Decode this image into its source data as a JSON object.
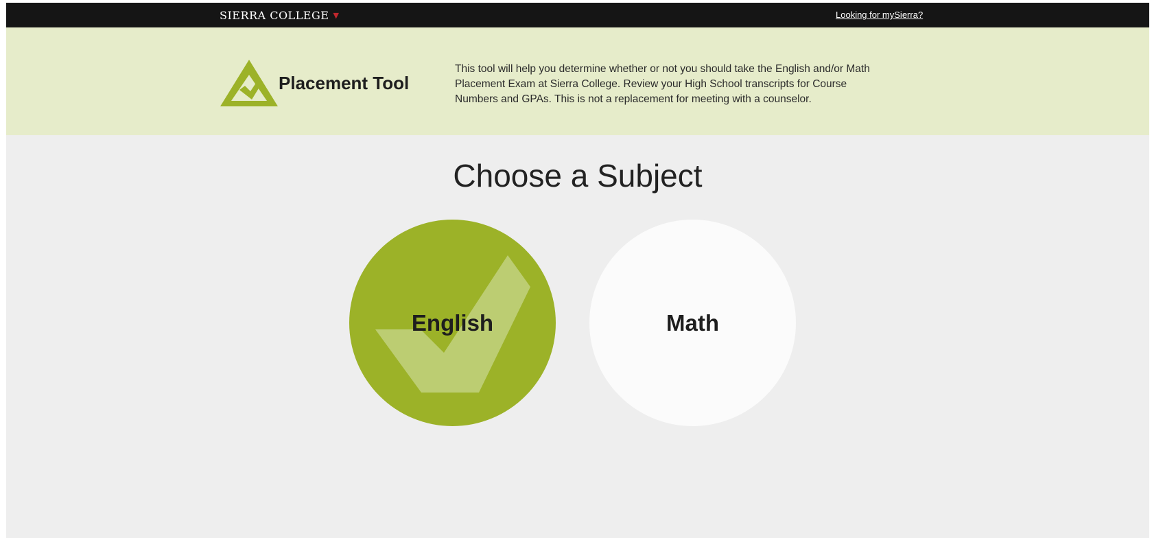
{
  "topbar": {
    "brand": "SIERRA COLLEGE",
    "link": "Looking for mySierra?"
  },
  "banner": {
    "tool_title": "Placement Tool",
    "intro_lines": [
      "This tool will help you determine whether or not you should take the English and/or Math",
      "Placement Exam at Sierra College. Review your High School transcripts for Course",
      "Numbers and GPAs. This is not a replacement for meeting with a counselor."
    ]
  },
  "main": {
    "heading": "Choose a Subject",
    "subjects": [
      {
        "label": "English",
        "selected": true
      },
      {
        "label": "Math",
        "selected": false
      }
    ]
  },
  "colors": {
    "accent": "#9cb228",
    "banner_bg": "#e6ecca",
    "topbar_bg": "#151515",
    "page_bg": "#eeeeee",
    "caret": "#c0272d"
  }
}
